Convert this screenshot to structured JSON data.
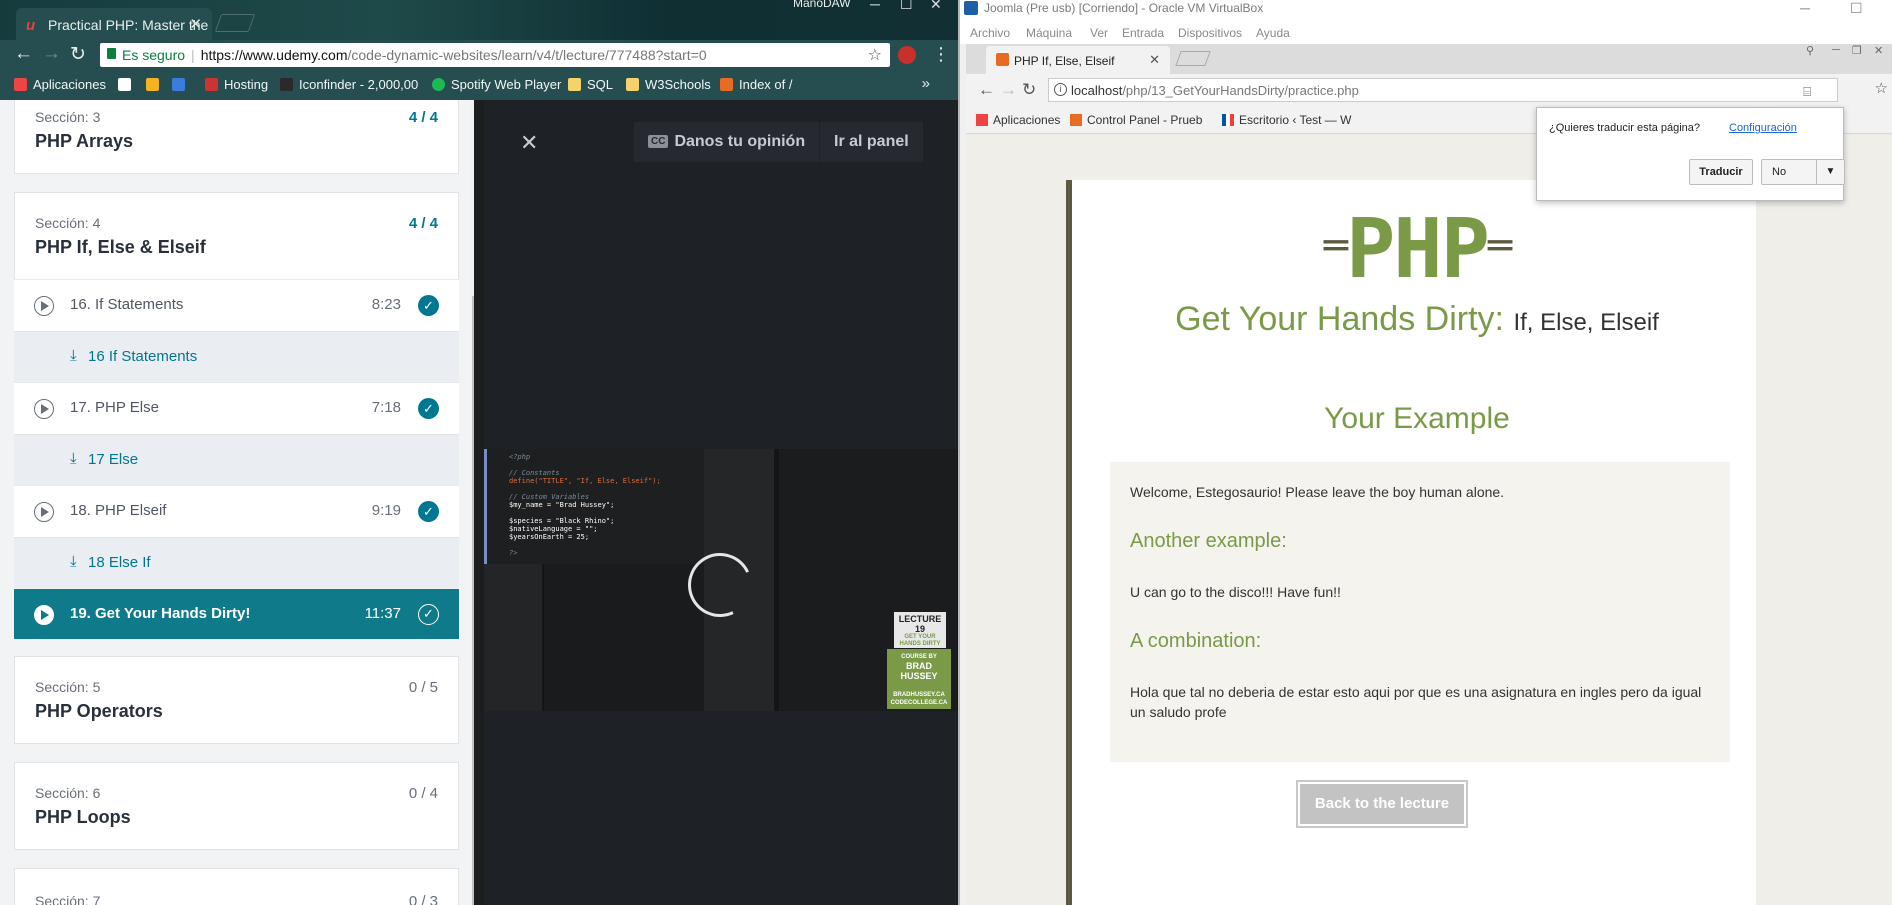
{
  "left_browser": {
    "tab_title": "Practical PHP: Master the",
    "user_label": "ManoDAW",
    "secure_label": "Es seguro",
    "url_host": "https://www.udemy.com",
    "url_path": "/code-dynamic-websites/learn/v4/t/lecture/777488?start=0",
    "bookmarks": [
      "Aplicaciones",
      "Hosting",
      "Iconfinder - 2,000,00",
      "Spotify Web Player",
      "SQL",
      "W3Schools",
      "Index of /"
    ],
    "more": "»"
  },
  "sidebar": {
    "sections": [
      {
        "label": "Sección: 3",
        "title": "PHP Arrays",
        "progress": "4 / 4"
      },
      {
        "label": "Sección: 4",
        "title": "PHP If, Else & Elseif",
        "progress": "4 / 4"
      },
      {
        "label": "Sección: 5",
        "title": "PHP Operators",
        "progress": "0 / 5"
      },
      {
        "label": "Sección: 6",
        "title": "PHP Loops",
        "progress": "0 / 4"
      },
      {
        "label": "Sección: 7",
        "title": "",
        "progress": "0 / 3"
      }
    ],
    "lectures": [
      {
        "title": "16.  If Statements",
        "duration": "8:23"
      },
      {
        "title": "17.  PHP Else",
        "duration": "7:18"
      },
      {
        "title": "18.  PHP Elseif",
        "duration": "9:19"
      },
      {
        "title": "19.  Get Your Hands Dirty!",
        "duration": "11:37"
      }
    ],
    "resources": [
      "16 If Statements",
      "17 Else",
      "18 Else If"
    ]
  },
  "video": {
    "feedback_label": "Danos tu opinión",
    "cc_label": "CC",
    "panel_label": "Ir al panel",
    "badge_lecture": "LECTURE 19",
    "badge_lecture_sub": "GET YOUR HANDS DIRTY",
    "badge_course": "COURSE BY",
    "badge_author": "BRAD HUSSEY",
    "badge_site1": "BRADHUSSEY.CA",
    "badge_site2": "CODECOLLEGE.CA",
    "code": {
      "open": "<?php",
      "c1": "// Constants",
      "define": "define(\"TITLE\", \"If, Else, Elseif\");",
      "c2": "// Custom Variables",
      "l1": "$my_name    = \"Brad Hussey\";",
      "l2": "$species    = \"Black Rhino\";",
      "l3": "$nativeLanguage = \"\";",
      "l4": "$yearsOnEarth   = 25;",
      "close": "?>"
    }
  },
  "right_vm": {
    "window_title": "Joomla (Pre usb) [Corriendo] - Oracle VM VirtualBox",
    "menu": [
      "Archivo",
      "Máquina",
      "Ver",
      "Entrada",
      "Dispositivos",
      "Ayuda"
    ],
    "tab_title": "PHP If, Else, Elseif",
    "url_host": "localhost",
    "url_path": "/php/13_GetYourHandsDirty/practice.php",
    "bookmarks": [
      "Aplicaciones",
      "Control Panel - Prueb",
      "Escritorio ‹ Test — W"
    ],
    "translate": {
      "question": "¿Quieres traducir esta página?",
      "settings": "Configuración",
      "translate_btn": "Traducir",
      "no_btn": "No"
    }
  },
  "practice_page": {
    "logo": "PHP",
    "heading": "Get Your Hands Dirty:",
    "heading_sub": "If, Else, Elseif",
    "example_heading": "Your Example",
    "welcome": "Welcome, Estegosaurio! Please leave the boy human alone.",
    "another_heading": "Another example:",
    "another_text": "U can go to the disco!!! Have fun!!",
    "combo_heading": "A combination:",
    "combo_text": "Hola que tal no deberia de estar esto aqui por que es una asignatura en ingles pero da igual un saludo profe",
    "back_button": "Back to the lecture"
  }
}
